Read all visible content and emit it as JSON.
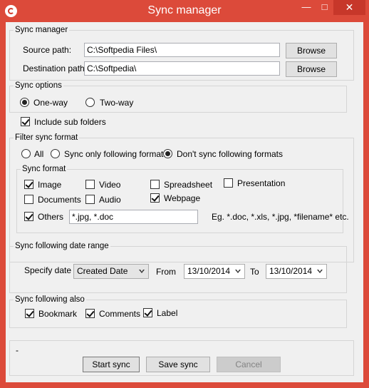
{
  "window": {
    "title": "Sync manager",
    "controls": {
      "minimize": "—",
      "maximize": "□",
      "close": "✕"
    },
    "accent_color": "#dc4a3a"
  },
  "sync_manager": {
    "legend": "Sync manager",
    "source_label": "Source path:",
    "source_value": "C:\\Softpedia Files\\",
    "destination_label": "Destination path:",
    "destination_value": "C:\\Softpedia\\",
    "browse_label": "Browse"
  },
  "sync_options": {
    "legend": "Sync options",
    "one_way": {
      "label": "One-way",
      "checked": true
    },
    "two_way": {
      "label": "Two-way",
      "checked": false
    },
    "include_sub_folders": {
      "label": "Include sub folders",
      "checked": true
    }
  },
  "filter": {
    "legend": "Filter sync format",
    "all": {
      "label": "All",
      "checked": false
    },
    "only_following": {
      "label": "Sync only following formats",
      "checked": false
    },
    "dont_sync": {
      "label": "Don't sync following formats",
      "checked": true
    },
    "sync_format": {
      "legend": "Sync format",
      "image": {
        "label": "Image",
        "checked": true
      },
      "video": {
        "label": "Video",
        "checked": false
      },
      "spreadsheet": {
        "label": "Spreadsheet",
        "checked": false
      },
      "presentation": {
        "label": "Presentation",
        "checked": false
      },
      "documents": {
        "label": "Documents",
        "checked": false
      },
      "audio": {
        "label": "Audio",
        "checked": false
      },
      "webpage": {
        "label": "Webpage",
        "checked": true
      },
      "others": {
        "label": "Others",
        "checked": true
      },
      "others_value": "*.jpg, *.doc",
      "example_hint": "Eg. *.doc, *.xls, *.jpg, *filename* etc."
    }
  },
  "date_range": {
    "legend": "Sync following date range",
    "specify_label": "Specify date",
    "date_type_selected": "Created Date",
    "from_label": "From",
    "from_value": "13/10/2014",
    "to_label": "To",
    "to_value": "13/10/2014"
  },
  "also": {
    "legend": "Sync following also",
    "bookmark": {
      "label": "Bookmark",
      "checked": true
    },
    "comments": {
      "label": "Comments",
      "checked": true
    },
    "label": {
      "label": "Label",
      "checked": true
    }
  },
  "footer": {
    "status_text": "-",
    "start_label": "Start sync",
    "save_label": "Save sync",
    "cancel_label": "Cancel"
  }
}
